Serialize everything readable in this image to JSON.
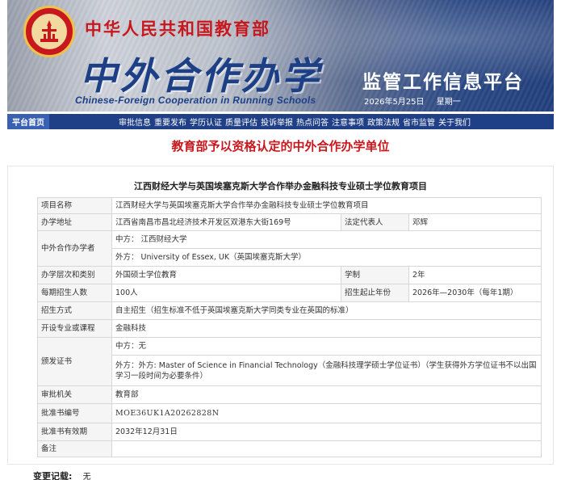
{
  "header": {
    "ministry": "中华人民共和国教育部",
    "title": "中外合作办学",
    "title_en": "Chinese-Foreign Cooperation in Running Schools",
    "platform": "监管工作信息平台",
    "date": "2026年5月25日",
    "weekday": "星期一"
  },
  "nav": {
    "home": "平台首页",
    "items": [
      "审批信息",
      "重要发布",
      "学历认证",
      "质量评估",
      "投诉举报",
      "热点问答",
      "注意事项",
      "政策法规",
      "省市监管",
      "关于我们"
    ]
  },
  "page_heading": "教育部予以资格认定的中外合作办学单位",
  "project": {
    "title": "江西财经大学与英国埃塞克斯大学合作举办金融科技专业硕士学位教育项目",
    "labels": {
      "name": "项目名称",
      "address": "办学地址",
      "legal_rep": "法定代表人",
      "partners": "中外合作办学者",
      "level": "办学层次和类别",
      "duration": "学制",
      "enrollment": "每期招生人数",
      "period": "招生起止年份",
      "method": "招生方式",
      "courses": "开设专业或课程",
      "certificate": "颁发证书",
      "authority": "审批机关",
      "approval_no": "批准书编号",
      "valid_until": "批准书有效期",
      "remarks": "备注"
    },
    "values": {
      "name": "江西财经大学与英国埃塞克斯大学合作举办金融科技专业硕士学位教育项目",
      "address": "江西省南昌市昌北经济技术开发区双港东大街169号",
      "legal_rep": "邓辉",
      "partner_cn": "中方：  江西财经大学",
      "partner_foreign": "外方：  University of Essex, UK（英国埃塞克斯大学）",
      "level": "外国硕士学位教育",
      "duration": "2年",
      "enrollment": "100人",
      "period": "2026年—2030年（每年1期）",
      "method": "自主招生（招生标准不低于英国埃塞克斯大学同类专业在英国的标准）",
      "courses": "金融科技",
      "cert_cn": "中方：无",
      "cert_foreign": "外方：外方: Master of Science in Financial Technology（金融科技理学硕士学位证书）（学生获得外方学位证书不以出国学习一段时间为必要条件）",
      "authority": "教育部",
      "approval_no": "MOE36UK1A20262828N",
      "valid_until": "2032年12月31日",
      "remarks": ""
    }
  },
  "change_record": {
    "label": "变更记载:",
    "value": "无"
  },
  "colors": {
    "nav_bg": "#1f3f86",
    "nav_home_bg": "#3960b1",
    "heading_red": "#c8171d",
    "title_blue": "#1d3f86"
  }
}
